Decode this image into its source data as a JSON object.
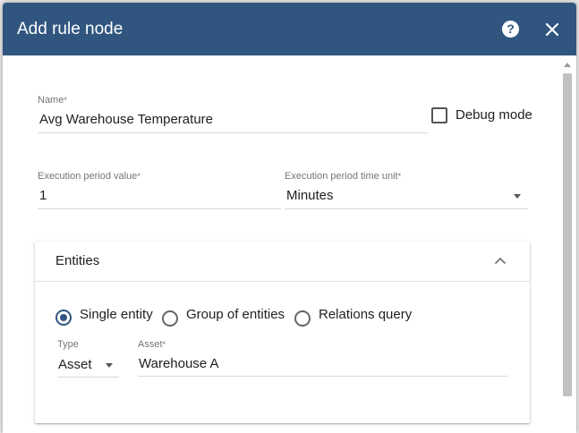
{
  "dialog": {
    "title": "Add rule node",
    "help_icon": "help-icon",
    "close_icon": "close-icon"
  },
  "form": {
    "name": {
      "label": "Name",
      "required_mark": "*",
      "value": "Avg Warehouse Temperature"
    },
    "debug_mode": {
      "label": "Debug mode",
      "checked": false
    },
    "execution_period_value": {
      "label": "Execution period value",
      "required_mark": "*",
      "value": "1"
    },
    "execution_period_time_unit": {
      "label": "Execution period time unit",
      "required_mark": "*",
      "value": "Minutes"
    }
  },
  "entities_panel": {
    "title": "Entities",
    "expanded": true,
    "radios": [
      {
        "label": "Single entity",
        "checked": true
      },
      {
        "label": "Group of entities",
        "checked": false
      },
      {
        "label": "Relations query",
        "checked": false
      }
    ],
    "type": {
      "label": "Type",
      "value": "Asset"
    },
    "asset": {
      "label": "Asset",
      "required_mark": "*",
      "value": "Warehouse A"
    }
  },
  "colors": {
    "header": "#305680",
    "accent": "#305680"
  }
}
